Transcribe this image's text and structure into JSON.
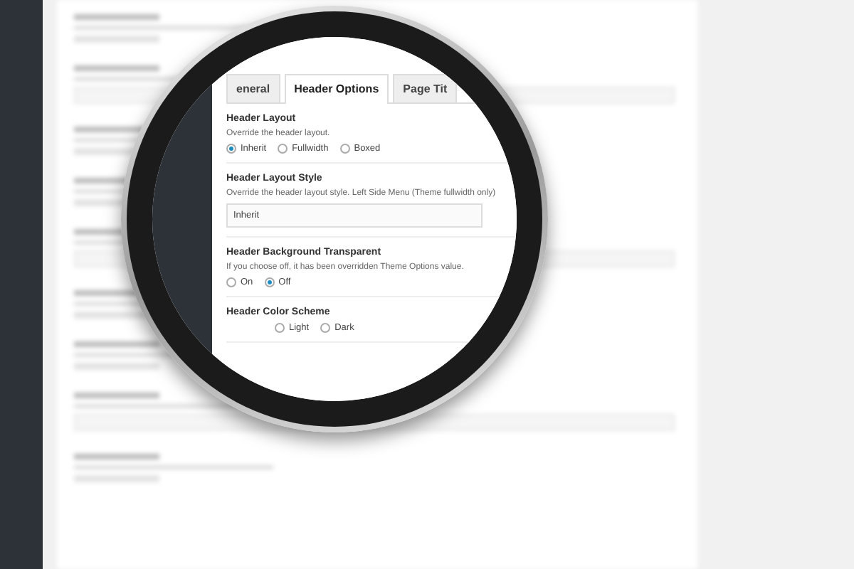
{
  "tabs": [
    {
      "label": "eneral",
      "selected": false
    },
    {
      "label": "Header Options",
      "selected": true
    },
    {
      "label": "Page Tit",
      "selected": false
    }
  ],
  "sections": [
    {
      "kind": "radio",
      "title": "Header Layout",
      "description": "Override the header layout.",
      "options": [
        {
          "label": "Inherit",
          "selected": true
        },
        {
          "label": "Fullwidth",
          "selected": false
        },
        {
          "label": "Boxed",
          "selected": false
        }
      ]
    },
    {
      "kind": "select",
      "title": "Header Layout Style",
      "description": "Override the header layout style. Left Side Menu (Theme fullwidth only)",
      "value": "Inherit"
    },
    {
      "kind": "radio",
      "title": "Header Background Transparent",
      "description": "If you choose off, it has been overridden Theme Options value.",
      "options": [
        {
          "label": "On",
          "selected": false
        },
        {
          "label": "Off",
          "selected": true
        }
      ]
    },
    {
      "kind": "radio",
      "title": "Header Color Scheme",
      "options": [
        {
          "label": "Light",
          "selected": false
        },
        {
          "label": "Dark",
          "selected": false
        }
      ]
    }
  ]
}
